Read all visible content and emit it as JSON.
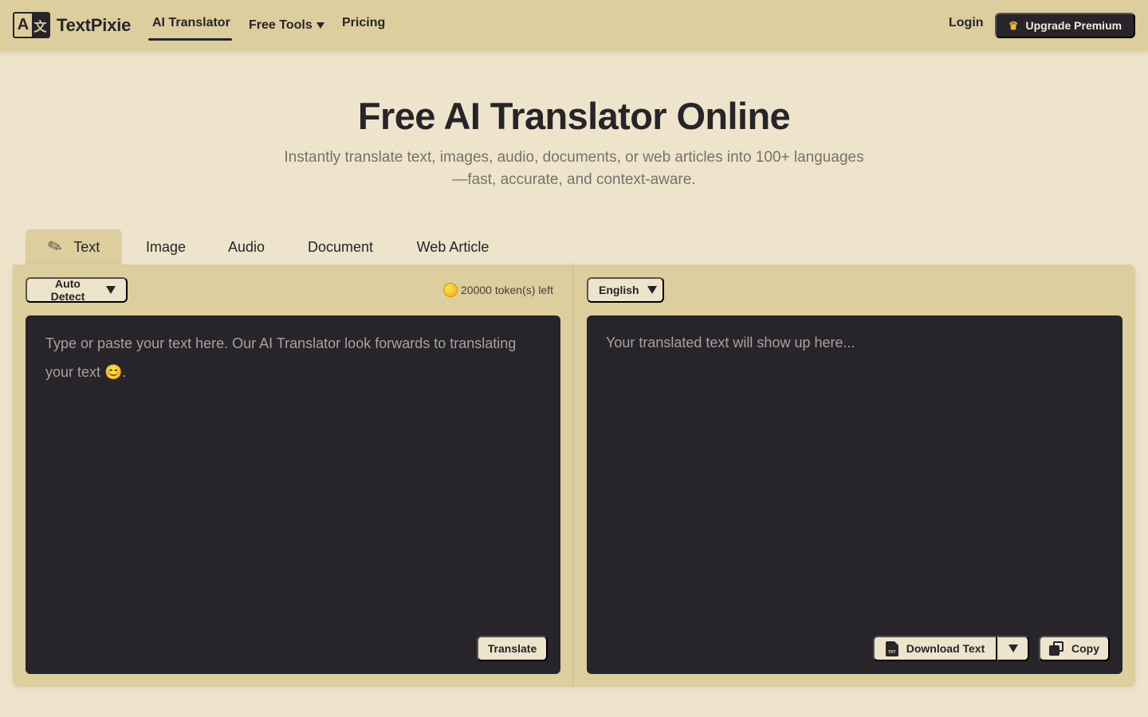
{
  "brand": {
    "name": "TextPixie",
    "logo_glyphs": [
      "A",
      "文"
    ]
  },
  "nav": {
    "ai_translator": "AI Translator",
    "free_tools": "Free Tools",
    "pricing": "Pricing",
    "login": "Login",
    "upgrade": "Upgrade Premium"
  },
  "hero": {
    "title": "Free AI Translator Online",
    "subtitle_line1": "Instantly translate text, images, audio, documents, or web articles into 100+ languages",
    "subtitle_line2": "—fast, accurate, and context-aware."
  },
  "tabs": [
    {
      "label": "Text",
      "icon": "pencil-icon",
      "active": true
    },
    {
      "label": "Image",
      "active": false
    },
    {
      "label": "Audio",
      "active": false
    },
    {
      "label": "Document",
      "active": false
    },
    {
      "label": "Web Article",
      "active": false
    }
  ],
  "source": {
    "language": "Auto Detect",
    "tokens_left": "20000 token(s) left",
    "placeholder": "Type or paste your text here. Our AI Translator look forwards to translating your text 😊.",
    "value": "",
    "translate_button": "Translate"
  },
  "target": {
    "language": "English",
    "placeholder": "Your translated text will show up here...",
    "download_button": "Download Text",
    "copy_button": "Copy"
  },
  "colors": {
    "page_bg": "#ede4cb",
    "nav_bg": "#dcce9d",
    "dark": "#27242a",
    "muted_text": "#78716c"
  }
}
